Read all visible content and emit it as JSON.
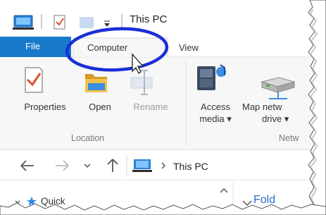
{
  "title_bar": {
    "title": "This PC"
  },
  "tabs": [
    {
      "label": "File"
    },
    {
      "label": "Computer"
    },
    {
      "label": "View"
    }
  ],
  "ribbon": {
    "buttons": [
      {
        "label": "Properties",
        "icon": "properties-icon",
        "enabled": true
      },
      {
        "label": "Open",
        "icon": "folder-icon",
        "enabled": true
      },
      {
        "label": "Rename",
        "icon": "rename-icon",
        "enabled": false
      },
      {
        "label": "Access",
        "label2": "media ▾",
        "icon": "media-icon",
        "enabled": true
      },
      {
        "label": "Map netw",
        "label2": "drive ▾",
        "icon": "network-drive-icon",
        "enabled": true
      }
    ],
    "groups": [
      {
        "label": "Location"
      },
      {
        "label": "Netw"
      }
    ]
  },
  "address_bar": {
    "location": "This PC"
  },
  "nav_pane": {
    "quick_access": "Quick",
    "folders": "Fold"
  },
  "colors": {
    "file_tab": "#1979ca",
    "highlight_ellipse": "#1b2fd6",
    "caption": "#777777"
  }
}
